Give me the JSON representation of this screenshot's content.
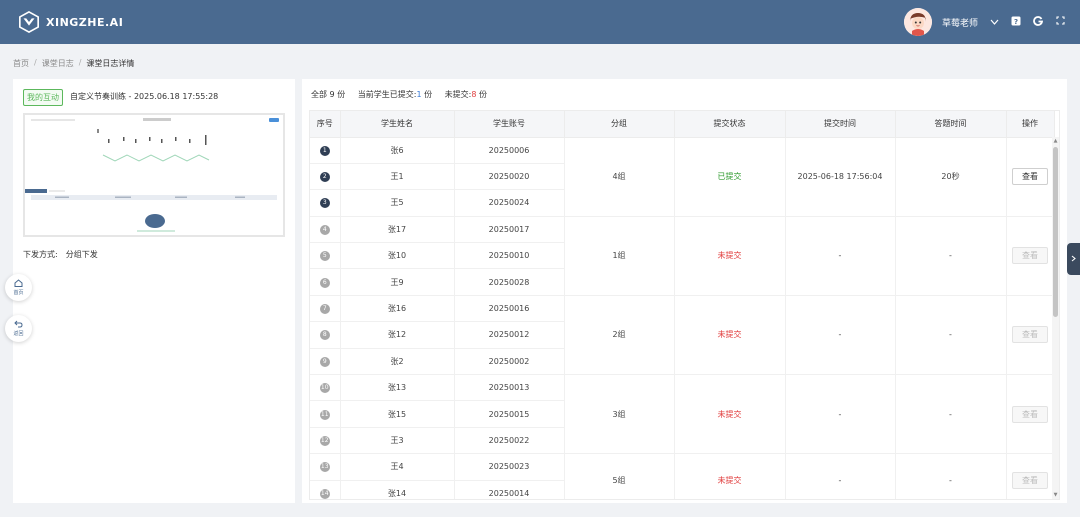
{
  "header": {
    "logo_text": "XINGZHE.AI",
    "user_name": "草莓老师",
    "icons": [
      "chevron-down-icon",
      "help-icon",
      "g-icon",
      "fullscreen-icon"
    ]
  },
  "breadcrumb": {
    "items": [
      "首页",
      "课堂日志",
      "课堂日志详情"
    ],
    "separator": "/"
  },
  "left_panel": {
    "tag": "我的互动",
    "lesson_title": "自定义节奏训练 - 2025.06.18 17:55:28",
    "issue_label": "下发方式:",
    "issue_value": "分组下发"
  },
  "float_buttons": {
    "home": "首页",
    "back": "返回"
  },
  "summary": {
    "total_label": "全部",
    "total_count": "9",
    "unit": "份",
    "submitted_label": "当前学生已提交:",
    "submitted_count": "1",
    "unsubmitted_label": "未提交:",
    "unsubmitted_count": "8"
  },
  "table": {
    "headers": [
      "序号",
      "学生姓名",
      "学生账号",
      "分组",
      "提交状态",
      "提交时间",
      "答题时间",
      "操作"
    ],
    "groups": [
      {
        "group": "4组",
        "status": "已提交",
        "submitted": true,
        "submit_time": "2025-06-18 17:56:04",
        "answer_time": "20秒",
        "action": "查看",
        "students": [
          {
            "index": "1",
            "name": "张6",
            "account": "20250006"
          },
          {
            "index": "2",
            "name": "王1",
            "account": "20250020"
          },
          {
            "index": "3",
            "name": "王5",
            "account": "20250024"
          }
        ]
      },
      {
        "group": "1组",
        "status": "未提交",
        "submitted": false,
        "submit_time": "-",
        "answer_time": "-",
        "action": "查看",
        "students": [
          {
            "index": "4",
            "name": "张17",
            "account": "20250017"
          },
          {
            "index": "5",
            "name": "张10",
            "account": "20250010"
          },
          {
            "index": "6",
            "name": "王9",
            "account": "20250028"
          }
        ]
      },
      {
        "group": "2组",
        "status": "未提交",
        "submitted": false,
        "submit_time": "-",
        "answer_time": "-",
        "action": "查看",
        "students": [
          {
            "index": "7",
            "name": "张16",
            "account": "20250016"
          },
          {
            "index": "8",
            "name": "张12",
            "account": "20250012"
          },
          {
            "index": "9",
            "name": "张2",
            "account": "20250002"
          }
        ]
      },
      {
        "group": "3组",
        "status": "未提交",
        "submitted": false,
        "submit_time": "-",
        "answer_time": "-",
        "action": "查看",
        "students": [
          {
            "index": "10",
            "name": "张13",
            "account": "20250013"
          },
          {
            "index": "11",
            "name": "张15",
            "account": "20250015"
          },
          {
            "index": "12",
            "name": "王3",
            "account": "20250022"
          }
        ]
      },
      {
        "group": "5组",
        "status": "未提交",
        "submitted": false,
        "submit_time": "-",
        "answer_time": "-",
        "action": "查看",
        "students": [
          {
            "index": "13",
            "name": "王4",
            "account": "20250023"
          },
          {
            "index": "14",
            "name": "张14",
            "account": "20250014"
          }
        ]
      }
    ]
  },
  "colors": {
    "header_bg": "#4a6a90",
    "submitted": "#2e9a2e",
    "unsubmitted": "#e03a3a",
    "index_dark": "#2f3e54",
    "index_grey": "#a8a8a8"
  }
}
